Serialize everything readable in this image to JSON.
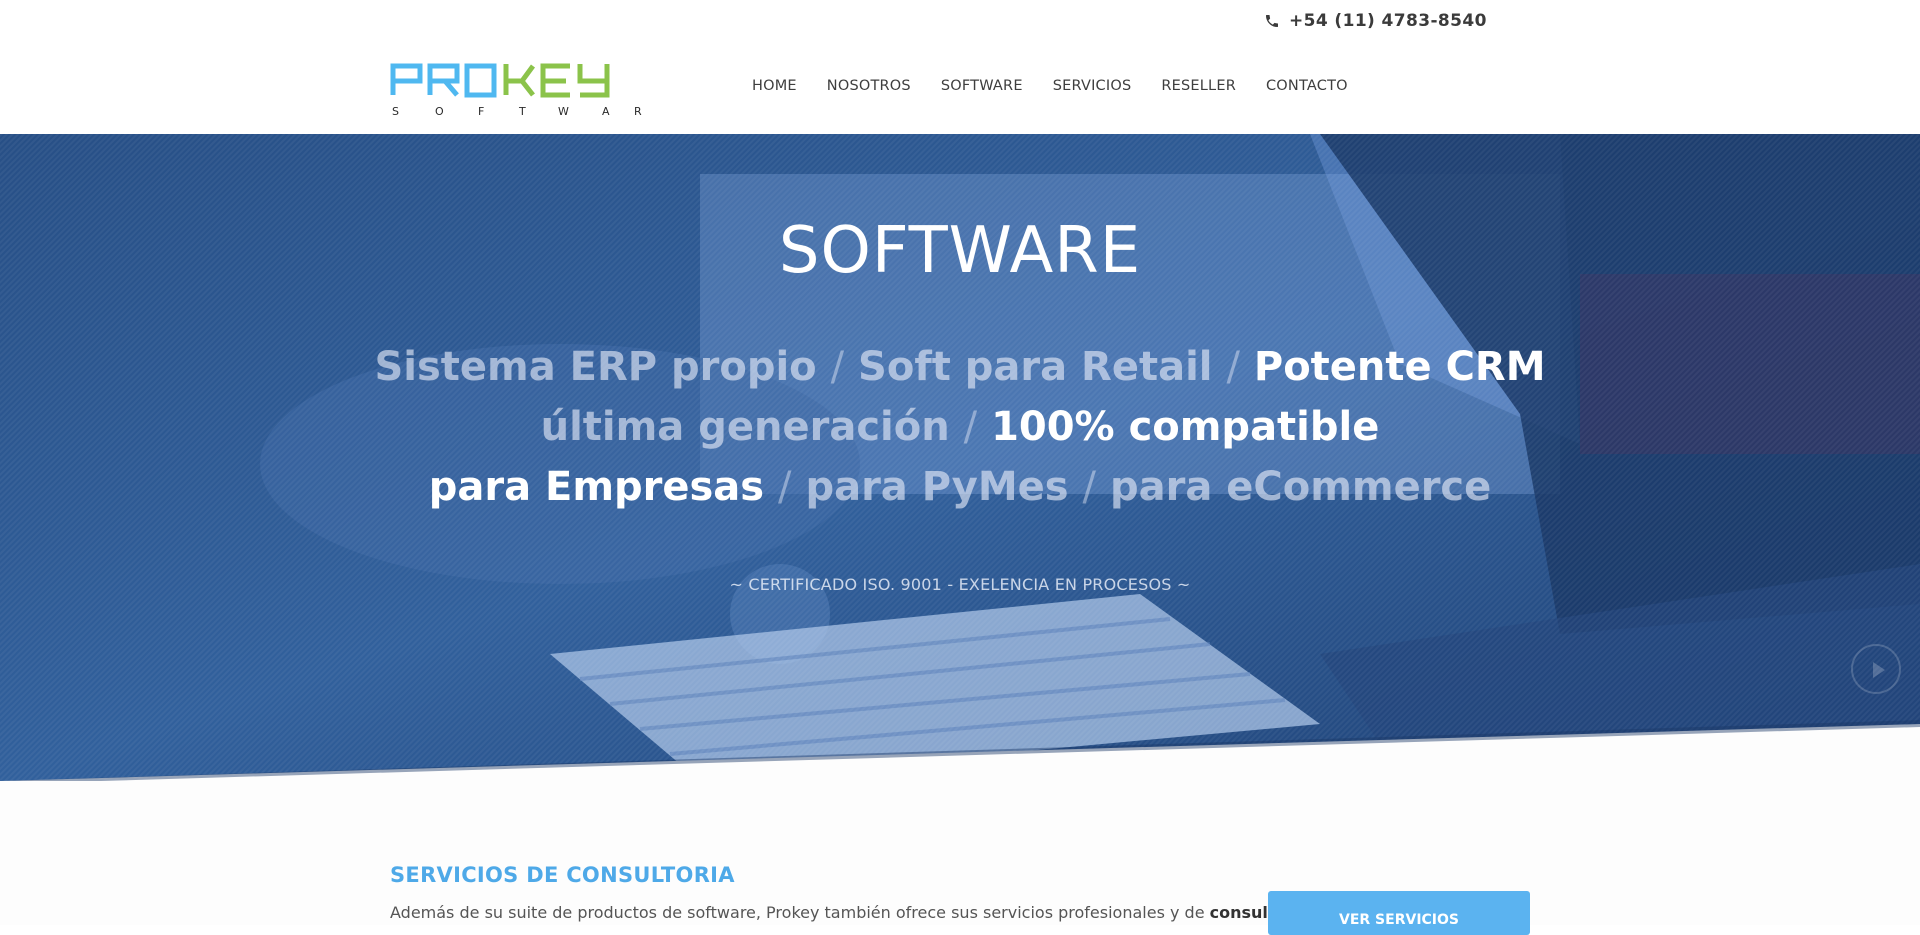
{
  "topbar": {
    "phone": "+54 (11) 4783-8540"
  },
  "logo": {
    "word_a": "PRO",
    "word_b": "KEY",
    "tagline": "S O F T W A R E"
  },
  "nav": [
    {
      "label": "HOME"
    },
    {
      "label": "NOSOTROS"
    },
    {
      "label": "SOFTWARE"
    },
    {
      "label": "SERVICIOS"
    },
    {
      "label": "RESELLER"
    },
    {
      "label": "CONTACTO"
    }
  ],
  "hero": {
    "title": "SOFTWARE",
    "line1": {
      "a": "Sistema ERP propio",
      "b": "Soft para Retail",
      "c": "Potente CRM"
    },
    "line2": {
      "a": "última generación",
      "b": "100% compatible"
    },
    "line3": {
      "a": "para Empresas",
      "b": "para PyMes",
      "c": "para eCommerce"
    },
    "separator": "/",
    "subtitle": "~ CERTIFICADO ISO. 9001 - EXELENCIA EN PROCESOS ~"
  },
  "consultoria": {
    "title": "SERVICIOS DE CONSULTORIA",
    "text": "Además de su suite de productos de software, Prokey también ofrece sus servicios profesionales y de",
    "text_bold": "consultoría a",
    "button": "VER SERVICIOS"
  },
  "colors": {
    "logo_blue": "#4fb8f0",
    "logo_green": "#8bc34a",
    "accent": "#4ea9e8",
    "hero_overlay": "#1e4b8c"
  }
}
